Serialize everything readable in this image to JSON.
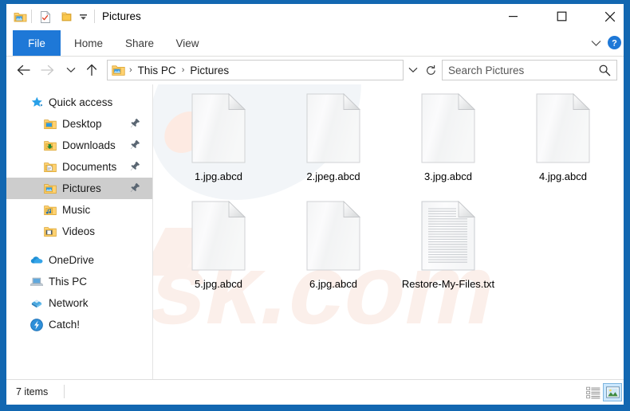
{
  "window": {
    "title": "Pictures",
    "quick_access_toolbar": [
      {
        "name": "folder-properties-icon",
        "label": "Pictures folder"
      },
      {
        "name": "properties-icon",
        "label": "Properties"
      },
      {
        "name": "new-folder-icon",
        "label": "New folder"
      },
      {
        "name": "customize-chevron-icon",
        "label": "Customize Quick Access Toolbar"
      }
    ],
    "controls": {
      "minimize": "–",
      "maximize": "□",
      "close": "✕"
    }
  },
  "ribbon": {
    "tabs": [
      {
        "label": "File",
        "active": true
      },
      {
        "label": "Home",
        "active": false
      },
      {
        "label": "Share",
        "active": false
      },
      {
        "label": "View",
        "active": false
      }
    ],
    "collapse_icon": "chevron-down-icon",
    "help_label": "?"
  },
  "addressbar": {
    "back_icon": "←",
    "forward_icon": "→",
    "recent_icon": "∨",
    "up_icon": "↑",
    "breadcrumbs": [
      "This PC",
      "Pictures"
    ],
    "separator": "›",
    "dropdown_icon": "∨",
    "refresh_icon": "↺"
  },
  "search": {
    "placeholder": "Search Pictures",
    "value": ""
  },
  "sidebar": {
    "items": [
      {
        "label": "Quick access",
        "icon": "star-icon",
        "level": 0,
        "pinned": false,
        "selected": false
      },
      {
        "label": "Desktop",
        "icon": "desktop-folder-icon",
        "level": 1,
        "pinned": true,
        "selected": false
      },
      {
        "label": "Downloads",
        "icon": "downloads-folder-icon",
        "level": 1,
        "pinned": true,
        "selected": false
      },
      {
        "label": "Documents",
        "icon": "documents-folder-icon",
        "level": 1,
        "pinned": true,
        "selected": false
      },
      {
        "label": "Pictures",
        "icon": "pictures-folder-icon",
        "level": 1,
        "pinned": true,
        "selected": true
      },
      {
        "label": "Music",
        "icon": "music-folder-icon",
        "level": 1,
        "pinned": false,
        "selected": false
      },
      {
        "label": "Videos",
        "icon": "videos-folder-icon",
        "level": 1,
        "pinned": false,
        "selected": false
      },
      {
        "label": "OneDrive",
        "icon": "onedrive-cloud-icon",
        "level": 0,
        "pinned": false,
        "selected": false
      },
      {
        "label": "This PC",
        "icon": "this-pc-icon",
        "level": 0,
        "pinned": false,
        "selected": false
      },
      {
        "label": "Network",
        "icon": "network-icon",
        "level": 0,
        "pinned": false,
        "selected": false
      },
      {
        "label": "Catch!",
        "icon": "catch-app-icon",
        "level": 0,
        "pinned": false,
        "selected": false
      }
    ]
  },
  "files": [
    {
      "name": "1.jpg.abcd",
      "icon": "blank-file-icon"
    },
    {
      "name": "2.jpeg.abcd",
      "icon": "blank-file-icon"
    },
    {
      "name": "3.jpg.abcd",
      "icon": "blank-file-icon"
    },
    {
      "name": "4.jpg.abcd",
      "icon": "blank-file-icon"
    },
    {
      "name": "5.jpg.abcd",
      "icon": "blank-file-icon"
    },
    {
      "name": "6.jpg.abcd",
      "icon": "blank-file-icon"
    },
    {
      "name": "Restore-My-Files.txt",
      "icon": "text-file-icon"
    }
  ],
  "statusbar": {
    "item_count": "7 items",
    "views": [
      {
        "name": "details-view-button",
        "label": "Details view",
        "active": false
      },
      {
        "name": "large-icons-view-button",
        "label": "Large icons view",
        "active": true
      }
    ]
  },
  "watermark": {
    "text": "isk.com"
  },
  "colors": {
    "window_border": "#1267b1",
    "active_tab": "#1e78d7",
    "selection": "#cdcdcd",
    "view_active": "#cce8ff",
    "text": "#1a1a1a",
    "watermark": "#fbf0ec"
  }
}
